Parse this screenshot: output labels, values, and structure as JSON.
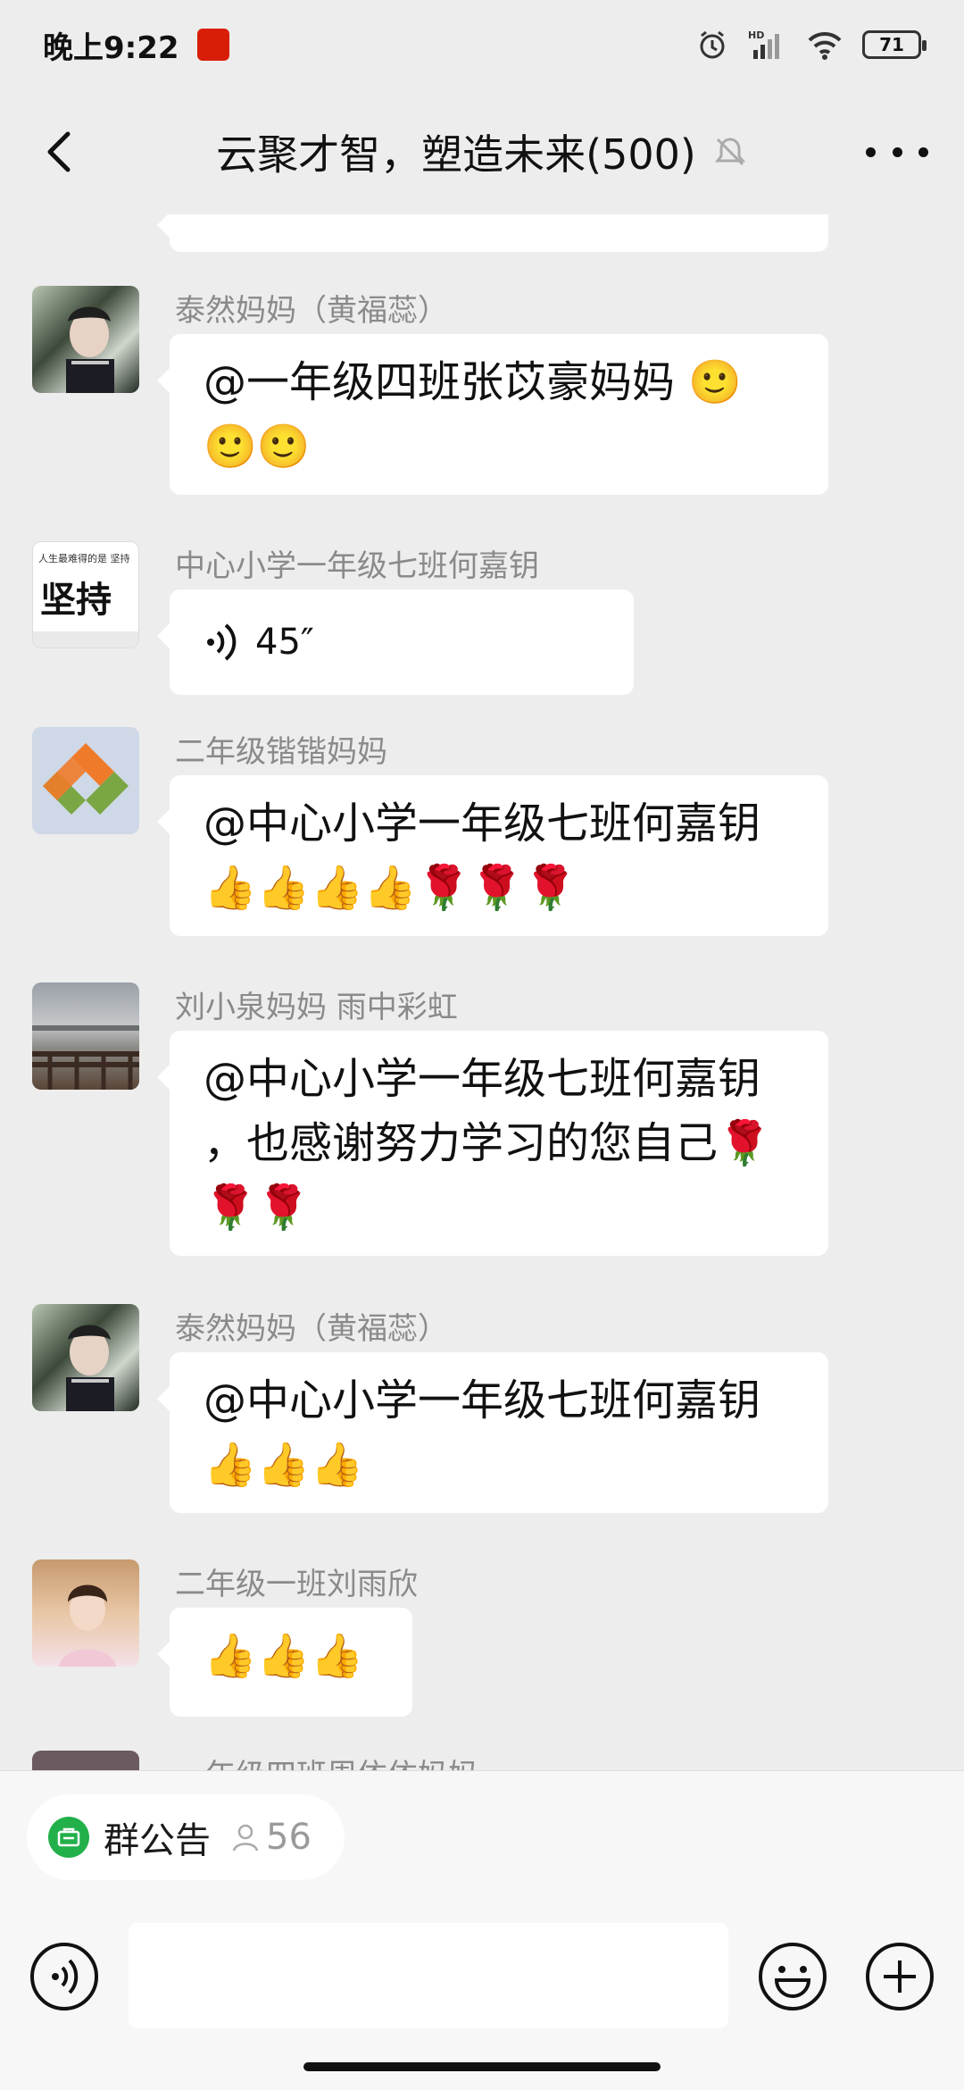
{
  "status_bar": {
    "time": "晚上9:22",
    "battery": "71",
    "network": "HD"
  },
  "header": {
    "title": "云聚才智，塑造未来(500)"
  },
  "messages": [
    {
      "content": "👍👍👍👍"
    },
    {
      "sender": "泰然妈妈（黄福蕊）",
      "content": "@一年级四班张苡豪妈妈 🙂\n🙂🙂"
    },
    {
      "sender": "中心小学一年级七班何嘉钥",
      "voice_duration": "45″",
      "avatar_text": "人生最难得的是 坚持"
    },
    {
      "sender": "二年级锴锴妈妈",
      "content": "@中心小学一年级七班何嘉钥\n👍👍👍👍🌹🌹🌹"
    },
    {
      "sender": "刘小泉妈妈  雨中彩虹",
      "content": "@中心小学一年级七班何嘉钥\n，也感谢努力学习的您自己🌹\n🌹🌹"
    },
    {
      "sender": "泰然妈妈（黄福蕊）",
      "content": "@中心小学一年级七班何嘉钥\n👍👍👍"
    },
    {
      "sender": "二年级一班刘雨欣",
      "content": "👍👍👍"
    },
    {
      "sender": "一年级四班周依依妈妈"
    }
  ],
  "bottom": {
    "notice_label": "群公告",
    "member_count": "56"
  },
  "colors": {
    "background": "#ededed",
    "accent_green": "#22b04a",
    "bubble": "#ffffff"
  }
}
